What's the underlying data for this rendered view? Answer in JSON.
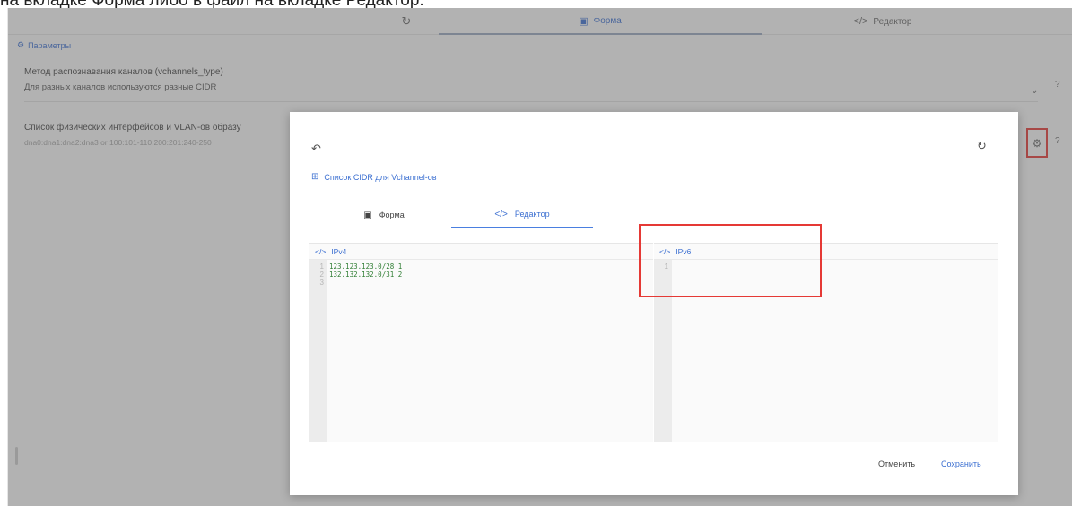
{
  "caption": "на вкладке Форма либо в файл на вкладке Редактор.",
  "top_tabs": {
    "refresh_icon": "refresh-icon",
    "form_label": "Форма",
    "editor_label": "Редактор"
  },
  "params_label": "Параметры",
  "field1": {
    "label": "Метод распознавания каналов (vchannels_type)",
    "value": "Для разных каналов используются разные CIDR"
  },
  "field2": {
    "label": "Список физических интерфейсов и VLAN-ов образу",
    "value": "dna0:dna1:dna2:dna3 or 100:101-110:200:201:240-250"
  },
  "dialog": {
    "title": "Список CIDR для Vchannel-ов",
    "tabs": [
      {
        "label": "Форма"
      },
      {
        "label": "Редактор"
      }
    ],
    "ipv4": {
      "title": "IPv4",
      "lines": [
        {
          "num": "1",
          "code": "123.123.123.0/28 1"
        },
        {
          "num": "2",
          "code": "132.132.132.0/31 2"
        },
        {
          "num": "3",
          "code": ""
        }
      ]
    },
    "ipv6": {
      "title": "IPv6",
      "lines": [
        {
          "num": "1",
          "code": ""
        }
      ]
    },
    "cancel_label": "Отменить",
    "save_label": "Сохранить"
  },
  "colors": {
    "accent": "#3b6fd1",
    "highlight": "#e53935",
    "code_text": "#2e7d32"
  }
}
